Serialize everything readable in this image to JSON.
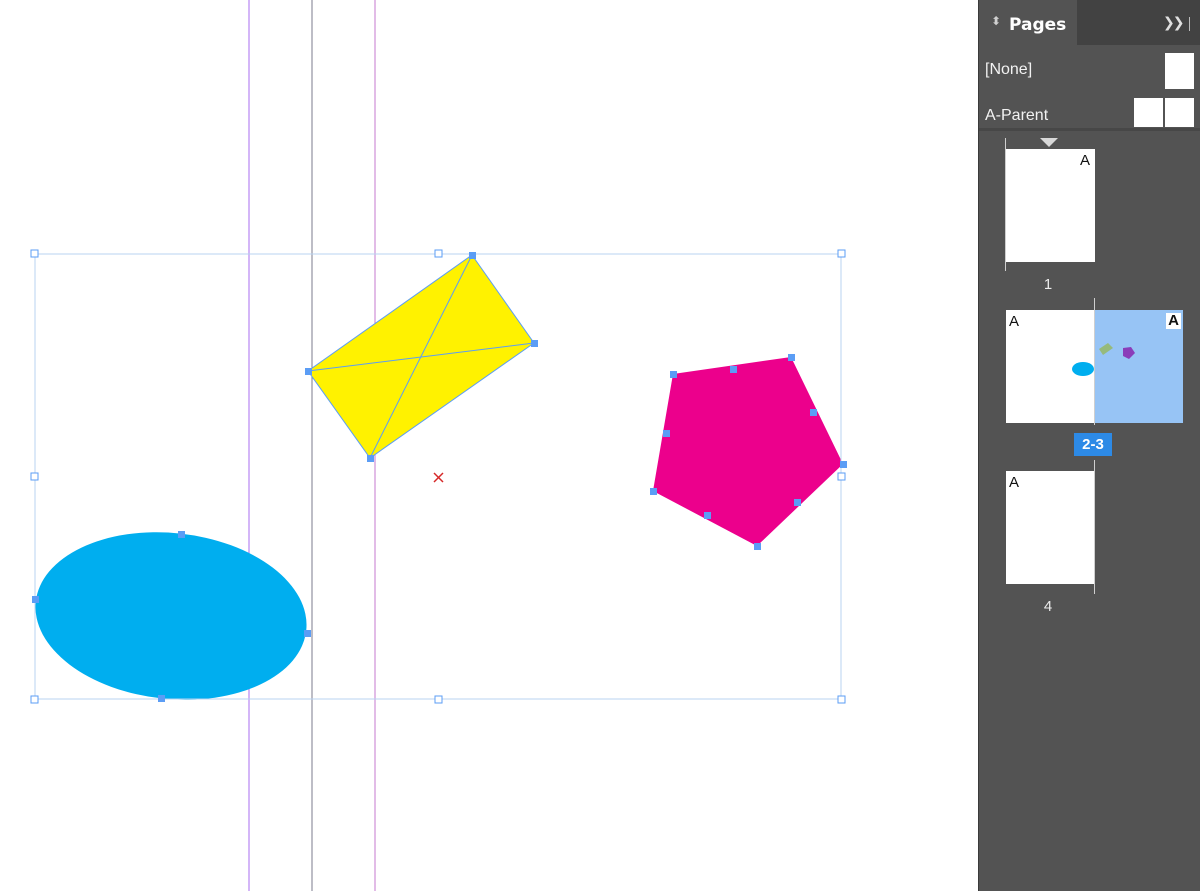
{
  "colors": {
    "ellipse_fill": "#00AEEF",
    "rectangle_fill": "#FFF200",
    "pentagon_fill": "#EC008C",
    "selection_blue": "#5B9DF5",
    "bounding_box": "#B9D3F0",
    "guide_purple": "#A86CF0",
    "guide_magenta": "#C47ACF",
    "guide_gray": "#7B7B8C",
    "center_marker": "#D62828",
    "panel_bg": "#535353",
    "spread_highlight": "#97C4F5",
    "badge_blue": "#2D8AE6"
  },
  "canvas": {
    "objects": [
      "ellipse",
      "rectangle-frame",
      "pentagon"
    ],
    "center_marker_icon": "cross-mark-icon"
  },
  "pages_panel": {
    "title": "Pages",
    "tab_icon": "double-arrow-updown-icon",
    "collapse_icon": "double-chevron-right-icon",
    "parents": [
      {
        "label": "[None]"
      },
      {
        "label": "A-Parent"
      }
    ],
    "pages": [
      {
        "number": "1",
        "parent_letter": "A"
      },
      {
        "spread_label": "2-3",
        "left_letter": "A",
        "right_letter": "A"
      },
      {
        "number": "4",
        "parent_letter": "A"
      }
    ]
  }
}
